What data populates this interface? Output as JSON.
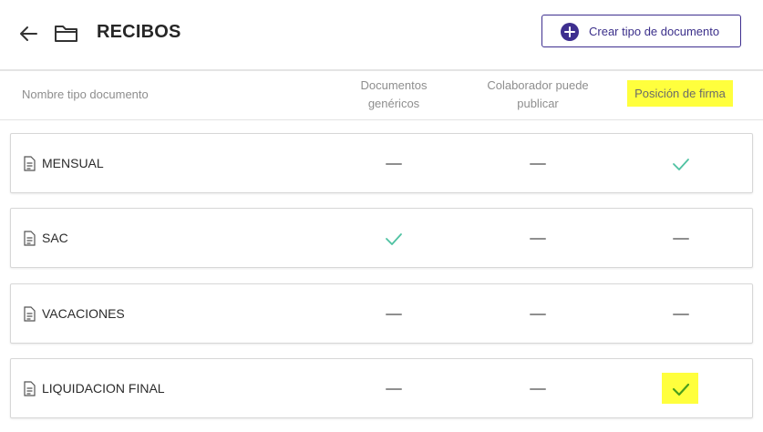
{
  "header": {
    "title": "RECIBOS",
    "create_button_label": "Crear tipo de documento"
  },
  "columns": {
    "name": "Nombre tipo documento",
    "generic_line1": "Documentos",
    "generic_line2": "genéricos",
    "collab_line1": "Colaborador puede",
    "collab_line2": "publicar",
    "firma": "Posición de firma"
  },
  "rows": [
    {
      "label": "MENSUAL",
      "generic": false,
      "collab": false,
      "firma": true
    },
    {
      "label": "SAC",
      "generic": true,
      "collab": false,
      "firma": false
    },
    {
      "label": "VACACIONES",
      "generic": false,
      "collab": false,
      "firma": false
    },
    {
      "label": "LIQUIDACION FINAL",
      "generic": false,
      "collab": false,
      "firma": true,
      "firma_highlighted": true
    }
  ],
  "colors": {
    "accent": "#3e2f8f",
    "check": "#4fc2a2",
    "check_highlighted": "#4a9e1c",
    "dash": "#8f8f8f",
    "highlight": "#ffff3d"
  }
}
